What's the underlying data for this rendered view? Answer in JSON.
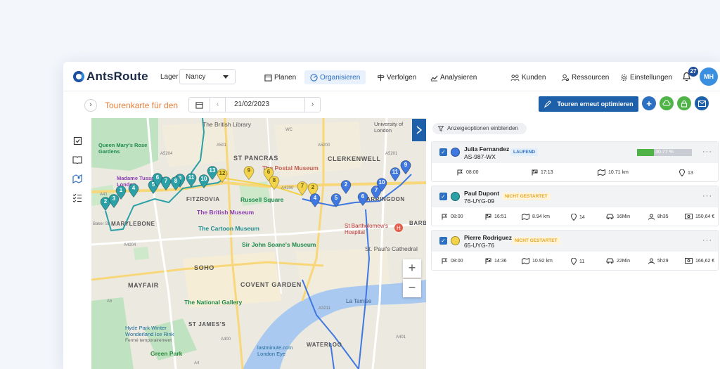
{
  "app": {
    "logo_text": "AntsRoute",
    "lager_label": "Lager",
    "lager_value": "Nancy"
  },
  "nav": {
    "planen": "Planen",
    "organisieren": "Organisieren",
    "verfolgen": "Verfolgen",
    "analysieren": "Analysieren",
    "kunden": "Kunden",
    "ressourcen": "Ressourcen",
    "einstellungen": "Einstellungen"
  },
  "user": {
    "notifications": "27",
    "initials": "MH"
  },
  "toolbar": {
    "title": "Tourenkarte für den",
    "date": "21/02/2023",
    "optimize_label": "Touren erneut optimieren"
  },
  "panel": {
    "display_options": "Anzeigeoptionen einblenden"
  },
  "drivers": [
    {
      "name": "Julia Fernandez",
      "plate": "AS-987-WX",
      "status": "LAUFEND",
      "color": "#3f78e0",
      "progress_label": "30.77 %",
      "progress": 0.3077,
      "stats": {
        "start": "08:00",
        "end": "17:13",
        "distance": "10.71 km",
        "stops": "13"
      }
    },
    {
      "name": "Paul Dupont",
      "plate": "76-UYG-09",
      "status": "NICHT GESTARTET",
      "color": "#2ba0a6",
      "stats": {
        "start": "08:00",
        "end": "16:51",
        "distance": "8.94 km",
        "stops": "14",
        "drive": "16Min",
        "work": "8h35",
        "cost": "150,64 €"
      }
    },
    {
      "name": "Pierre Rodriguez",
      "plate": "65-UYG-76",
      "status": "NICHT GESTARTET",
      "color": "#f2d34a",
      "stats": {
        "start": "08:00",
        "end": "14:36",
        "distance": "10.92 km",
        "stops": "11",
        "drive": "22Min",
        "work": "5h29",
        "cost": "166,62 €"
      }
    }
  ],
  "map": {
    "labels": {
      "british_library": "The British Library",
      "st_pancras": "ST PANCRAS",
      "clerkenwell": "CLERKENWELL",
      "university_london": "University of London",
      "queen_marys": "Queen Mary's Rose Gardens",
      "postal_museum": "The Postal Museum",
      "madame_tussauds": "Madame Tussauds London",
      "fitzrovia": "FITZROVIA",
      "russell_square": "Russell Square",
      "farringdon": "FARRINGDON",
      "marylebone": "MARYLEBONE",
      "british_museum": "The British Museum",
      "barts": "St Bartholomew's Hospital",
      "cartoon_museum": "The Cartoon Museum",
      "soane": "Sir John Soane's Museum",
      "st_pauls": "St. Paul's Cathedral",
      "soho": "SOHO",
      "mayfair": "MAYFAIR",
      "covent_garden": "COVENT GARDEN",
      "national_gallery": "The National Gallery",
      "la_tamise": "La Tamise",
      "hyde_park": "Hyde Park Winter Wonderland Ice Rink",
      "ferme": "Fermé temporairement",
      "st_james": "ST JAMES'S",
      "green_park": "Green Park",
      "london_eye": "lastminute.com London Eye",
      "waterloo": "WATERLOO",
      "barb": "BARB",
      "wc": "WC",
      "a501": "A501",
      "a5200": "A5200",
      "a5204": "A5204",
      "a4200": "A4200",
      "a5201": "A5201",
      "a41": "A41",
      "a5": "A5",
      "a4204": "A4204",
      "a400": "A400",
      "a4": "A4",
      "a3211": "A3211",
      "a401": "A401",
      "baker_st": "Baker St"
    },
    "markers": [
      {
        "n": "2",
        "c": "teal"
      },
      {
        "n": "3",
        "c": "teal"
      },
      {
        "n": "1",
        "c": "teal"
      },
      {
        "n": "4",
        "c": "teal"
      },
      {
        "n": "5",
        "c": "teal"
      },
      {
        "n": "6",
        "c": "teal"
      },
      {
        "n": "7",
        "c": "teal"
      },
      {
        "n": "9",
        "c": "teal"
      },
      {
        "n": "8",
        "c": "teal"
      },
      {
        "n": "11",
        "c": "teal"
      },
      {
        "n": "10",
        "c": "teal"
      },
      {
        "n": "13",
        "c": "teal"
      },
      {
        "n": "12",
        "c": "yellow"
      },
      {
        "n": "9",
        "c": "yellow"
      },
      {
        "n": "6",
        "c": "yellow"
      },
      {
        "n": "8",
        "c": "yellow"
      },
      {
        "n": "7",
        "c": "yellow"
      },
      {
        "n": "2",
        "c": "yellow"
      },
      {
        "n": "4",
        "c": "blue"
      },
      {
        "n": "2",
        "c": "blue"
      },
      {
        "n": "5",
        "c": "blue"
      },
      {
        "n": "6",
        "c": "blue"
      },
      {
        "n": "7",
        "c": "blue"
      },
      {
        "n": "10",
        "c": "blue"
      },
      {
        "n": "11",
        "c": "blue"
      },
      {
        "n": "8",
        "c": "blue"
      },
      {
        "n": "9",
        "c": "blue"
      }
    ]
  },
  "colors": {
    "accent": "#1d5fa8",
    "title_orange": "#e57f3a",
    "teal": "#2ba0a6",
    "yellow": "#f2d34a",
    "blue": "#3f78e0",
    "add": "#2d6fc0",
    "cloud": "#4fb347",
    "lock": "#4fb347",
    "mail": "#1d5fa8"
  }
}
